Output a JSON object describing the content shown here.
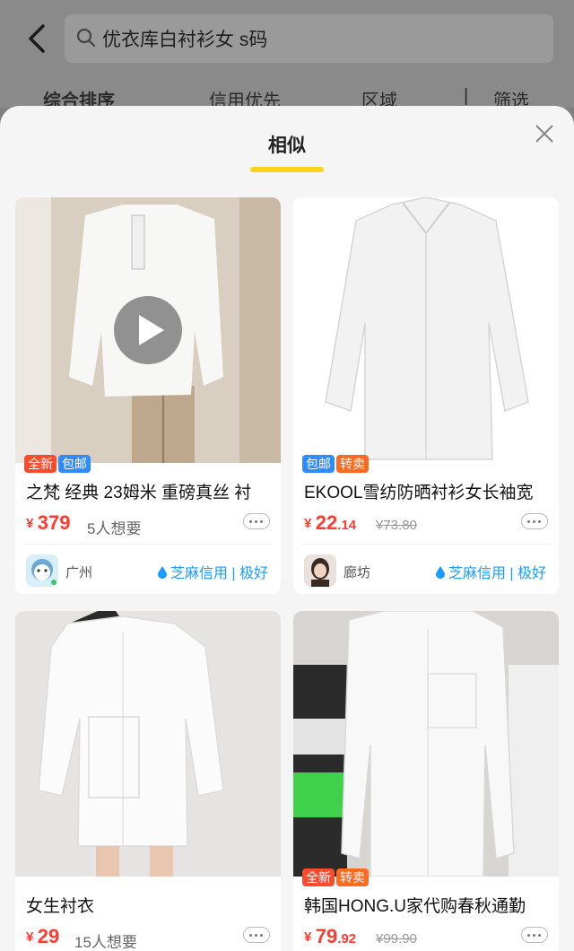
{
  "header": {
    "search_text": "优衣库白衬衫女 s码",
    "filters": [
      "综合排序",
      "信用优先",
      "区域",
      "|",
      "筛选"
    ]
  },
  "sheet": {
    "title": "相似"
  },
  "products": [
    {
      "tags": [
        "全新",
        "包邮"
      ],
      "title": "之梵 经典 23姆米 重磅真丝  衬",
      "currency": "¥",
      "price_int": "379",
      "price_dec": "",
      "wants": "5人想要",
      "original_price": "",
      "location": "广州",
      "credit": "芝麻信用 | 极好"
    },
    {
      "tags": [
        "包邮",
        "转卖"
      ],
      "title": "EKOOL雪纺防晒衬衫女长袖宽",
      "currency": "¥",
      "price_int": "22",
      "price_dec": ".14",
      "wants": "",
      "original_price": "¥73.80",
      "location": "廊坊",
      "credit": "芝麻信用 | 极好"
    },
    {
      "tags": [],
      "title": "女生衬衣",
      "currency": "¥",
      "price_int": "29",
      "price_dec": "",
      "wants": "15人想要",
      "original_price": ""
    },
    {
      "tags": [
        "全新",
        "转卖"
      ],
      "title": "韩国HONG.U家代购春秋通勤",
      "currency": "¥",
      "price_int": "79",
      "price_dec": ".92",
      "wants": "",
      "original_price": "¥99.90"
    }
  ],
  "colors": {
    "accent_yellow": "#ffd21f",
    "price_red": "#ff3b2f",
    "credit_blue": "#1a9cff"
  },
  "icons": [
    "back-arrow-icon",
    "search-icon",
    "close-icon",
    "play-icon",
    "more-options-icon",
    "sesame-credit-icon"
  ]
}
